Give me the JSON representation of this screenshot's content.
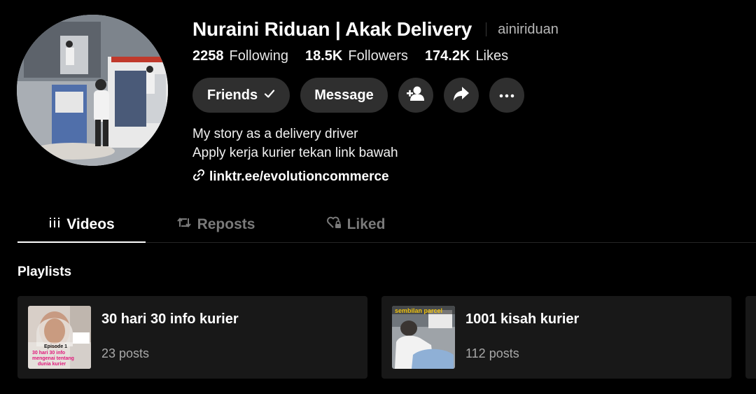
{
  "profile": {
    "display_name": "Nuraini Riduan | Akak Delivery",
    "username": "ainiriduan",
    "avatar_icon": "profile-photo"
  },
  "stats": [
    {
      "value": "2258",
      "label": "Following"
    },
    {
      "value": "18.5K",
      "label": "Followers"
    },
    {
      "value": "174.2K",
      "label": "Likes"
    }
  ],
  "actions": {
    "friends_label": "Friends",
    "friends_icon": "checkmark-icon",
    "message_label": "Message",
    "add_friend_icon": "person-add-icon",
    "share_icon": "share-arrow-icon",
    "more_icon": "ellipsis-icon"
  },
  "bio": {
    "lines": [
      "My story as a delivery driver",
      "Apply kerja kurier tekan link bawah"
    ]
  },
  "link": {
    "text": "linktr.ee/evolutioncommerce",
    "icon": "link-icon"
  },
  "tabs": [
    {
      "label": "Videos",
      "icon": "grid-bars-icon",
      "active": true
    },
    {
      "label": "Reposts",
      "icon": "repost-icon",
      "active": false
    },
    {
      "label": "Liked",
      "icon": "heart-lock-icon",
      "active": false
    }
  ],
  "playlists": {
    "heading": "Playlists",
    "items": [
      {
        "title": "30 hari 30 info kurier",
        "count": "23 posts",
        "thumb_text": [
          "Episode 1",
          "30 hari 30 info",
          "mengenai tentang",
          "dunia kurier"
        ]
      },
      {
        "title": "1001 kisah kurier",
        "count": "112 posts",
        "thumb_text": [
          "sembilan parcel"
        ]
      }
    ]
  },
  "colors": {
    "background": "#000000",
    "button_bg": "#2f2f2f",
    "card_bg": "#181818",
    "muted_text": "#a8a8a8",
    "inactive_tab": "#7a7a7a"
  }
}
